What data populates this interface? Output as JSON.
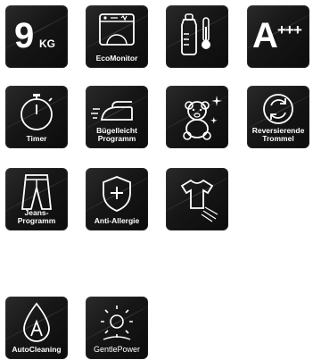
{
  "tiles": {
    "capacity": {
      "value": "9",
      "unit": "KG"
    },
    "ecomonitor": {
      "label": "EcoMonitor"
    },
    "baby": {
      "label": ""
    },
    "energy": {
      "letter": "A",
      "plus": "+++"
    },
    "timer": {
      "label": "Timer"
    },
    "ironing": {
      "label": "Bügelleicht\nProgramm"
    },
    "teddy": {
      "label": ""
    },
    "reverse": {
      "label": "Reversierende\nTrommel"
    },
    "jeans": {
      "label": "Jeans-\nProgramm"
    },
    "allergy": {
      "label": "Anti-Allergie"
    },
    "shirt": {
      "label": ""
    },
    "autocleaning": {
      "label": "AutoCleaning"
    },
    "gentlepower": {
      "label": "GentlePower"
    }
  },
  "colors": {
    "tile_bg": "#161616",
    "text": "#ffffff"
  }
}
